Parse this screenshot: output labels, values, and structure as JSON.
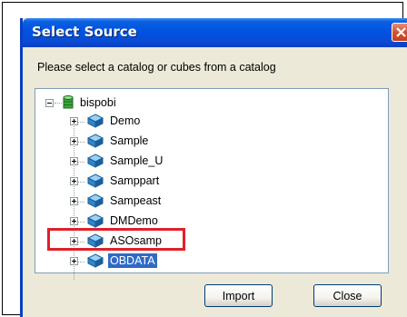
{
  "dialog": {
    "title": "Select Source",
    "prompt": "Please select a catalog or cubes from a catalog"
  },
  "tree": {
    "root": {
      "label": "bispobi",
      "icon": "database-icon",
      "expanded": true
    },
    "children": [
      {
        "label": "Demo",
        "icon": "cube-icon"
      },
      {
        "label": "Sample",
        "icon": "cube-icon"
      },
      {
        "label": "Sample_U",
        "icon": "cube-icon"
      },
      {
        "label": "Samppart",
        "icon": "cube-icon"
      },
      {
        "label": "Sampeast",
        "icon": "cube-icon"
      },
      {
        "label": "DMDemo",
        "icon": "cube-icon"
      },
      {
        "label": "ASOsamp",
        "icon": "cube-icon"
      },
      {
        "label": "OBDATA",
        "icon": "cube-icon",
        "selected": true
      }
    ]
  },
  "buttons": {
    "import_label": "Import",
    "close_label": "Close"
  },
  "colors": {
    "title_bar": "#0053e1",
    "selection": "#316ac5",
    "highlight_box": "#e0202a",
    "dialog_bg": "#ece9d8"
  }
}
